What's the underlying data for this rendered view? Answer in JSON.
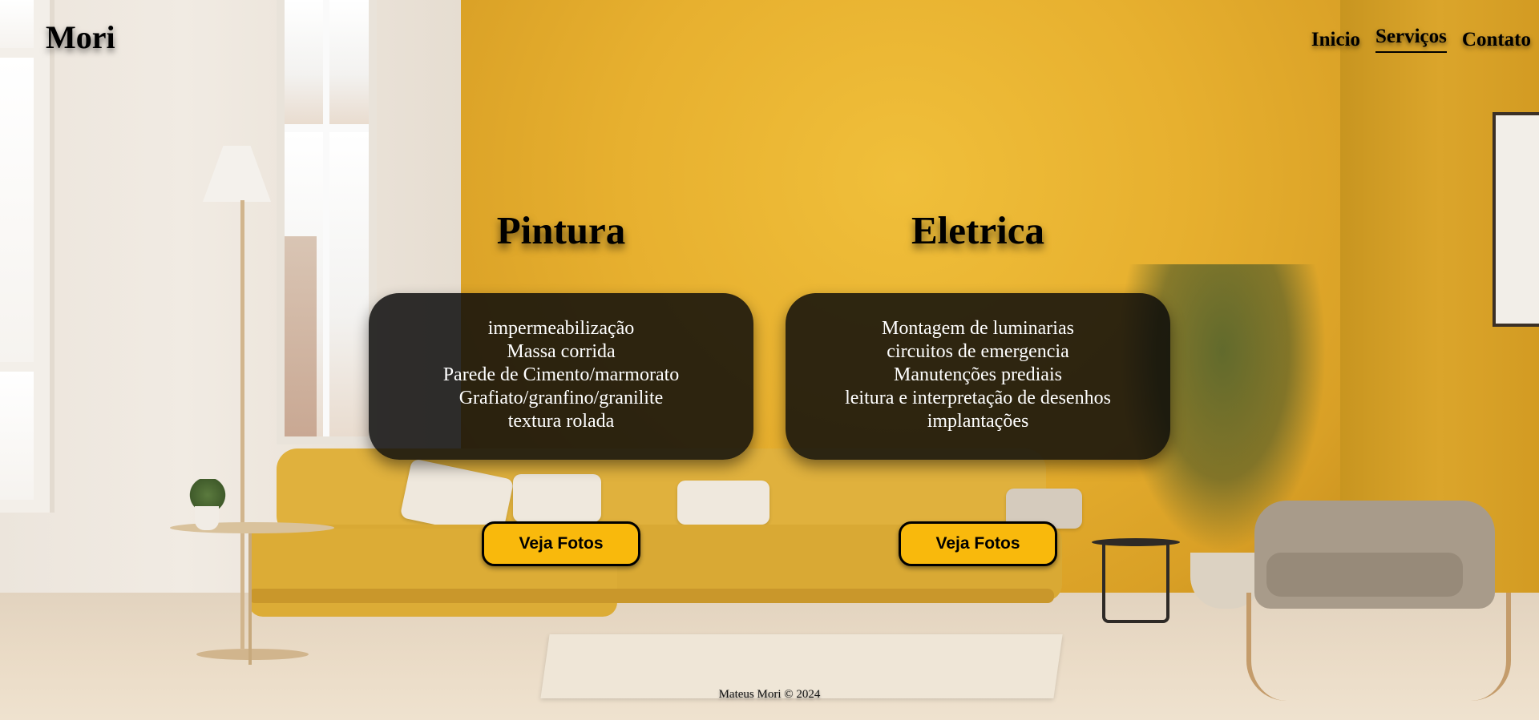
{
  "header": {
    "logo": "Mori",
    "nav": [
      {
        "label": "Inicio",
        "active": false
      },
      {
        "label": "Serviços",
        "active": true
      },
      {
        "label": "Contato",
        "active": false
      }
    ]
  },
  "services": [
    {
      "title": "Pintura",
      "items": [
        "impermeabilização",
        "Massa corrida",
        "Parede de Cimento/marmorato",
        "Grafiato/granfino/granilite",
        "textura rolada"
      ],
      "button_label": "Veja Fotos"
    },
    {
      "title": "Eletrica",
      "items": [
        "Montagem de luminarias",
        "circuitos de emergencia",
        "Manutenções prediais",
        "leitura e interpretação de desenhos",
        "implantações"
      ],
      "button_label": "Veja Fotos"
    }
  ],
  "footer": {
    "text": "Mateus Mori © 2024"
  },
  "colors": {
    "button": "#f9b90c",
    "card": "#0a0a0a",
    "wall": "#e7b02f"
  }
}
